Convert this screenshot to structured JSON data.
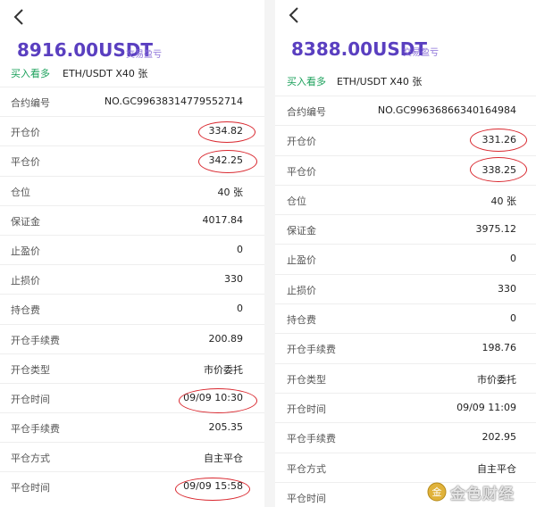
{
  "left": {
    "amount": "8916.00USDT",
    "amount_label": "交易盈亏",
    "side": "买入看多",
    "pair": "ETH/USDT X40 张",
    "rows": [
      {
        "label": "合约编号",
        "value": "NO.GC99638314779552714"
      },
      {
        "label": "开仓价",
        "value": "334.82"
      },
      {
        "label": "平仓价",
        "value": "342.25"
      },
      {
        "label": "仓位",
        "value": "40 张"
      },
      {
        "label": "保证金",
        "value": "4017.84"
      },
      {
        "label": "止盈价",
        "value": "0"
      },
      {
        "label": "止损价",
        "value": "330"
      },
      {
        "label": "持仓费",
        "value": "0"
      },
      {
        "label": "开仓手续费",
        "value": "200.89"
      },
      {
        "label": "开仓类型",
        "value": "市价委托"
      },
      {
        "label": "开仓时间",
        "value": "09/09 10:30"
      },
      {
        "label": "平仓手续费",
        "value": "205.35"
      },
      {
        "label": "平仓方式",
        "value": "自主平仓"
      },
      {
        "label": "平仓时间",
        "value": "09/09 15:58"
      }
    ]
  },
  "right": {
    "amount": "8388.00USDT",
    "amount_label": "交易盈亏",
    "side": "买入看多",
    "pair": "ETH/USDT X40 张",
    "rows": [
      {
        "label": "合约编号",
        "value": "NO.GC99636866340164984"
      },
      {
        "label": "开仓价",
        "value": "331.26"
      },
      {
        "label": "平仓价",
        "value": "338.25"
      },
      {
        "label": "仓位",
        "value": "40 张"
      },
      {
        "label": "保证金",
        "value": "3975.12"
      },
      {
        "label": "止盈价",
        "value": "0"
      },
      {
        "label": "止损价",
        "value": "330"
      },
      {
        "label": "持仓费",
        "value": "0"
      },
      {
        "label": "开仓手续费",
        "value": "198.76"
      },
      {
        "label": "开仓类型",
        "value": "市价委托"
      },
      {
        "label": "开仓时间",
        "value": "09/09 11:09"
      },
      {
        "label": "平仓手续费",
        "value": "202.95"
      },
      {
        "label": "平仓方式",
        "value": "自主平仓"
      },
      {
        "label": "平仓时间",
        "value": ""
      }
    ]
  },
  "watermark": {
    "text": "金色财经"
  },
  "colors": {
    "amount": "#5a3fc0",
    "side": "#1aa05a",
    "annotation": "#d9272e"
  }
}
